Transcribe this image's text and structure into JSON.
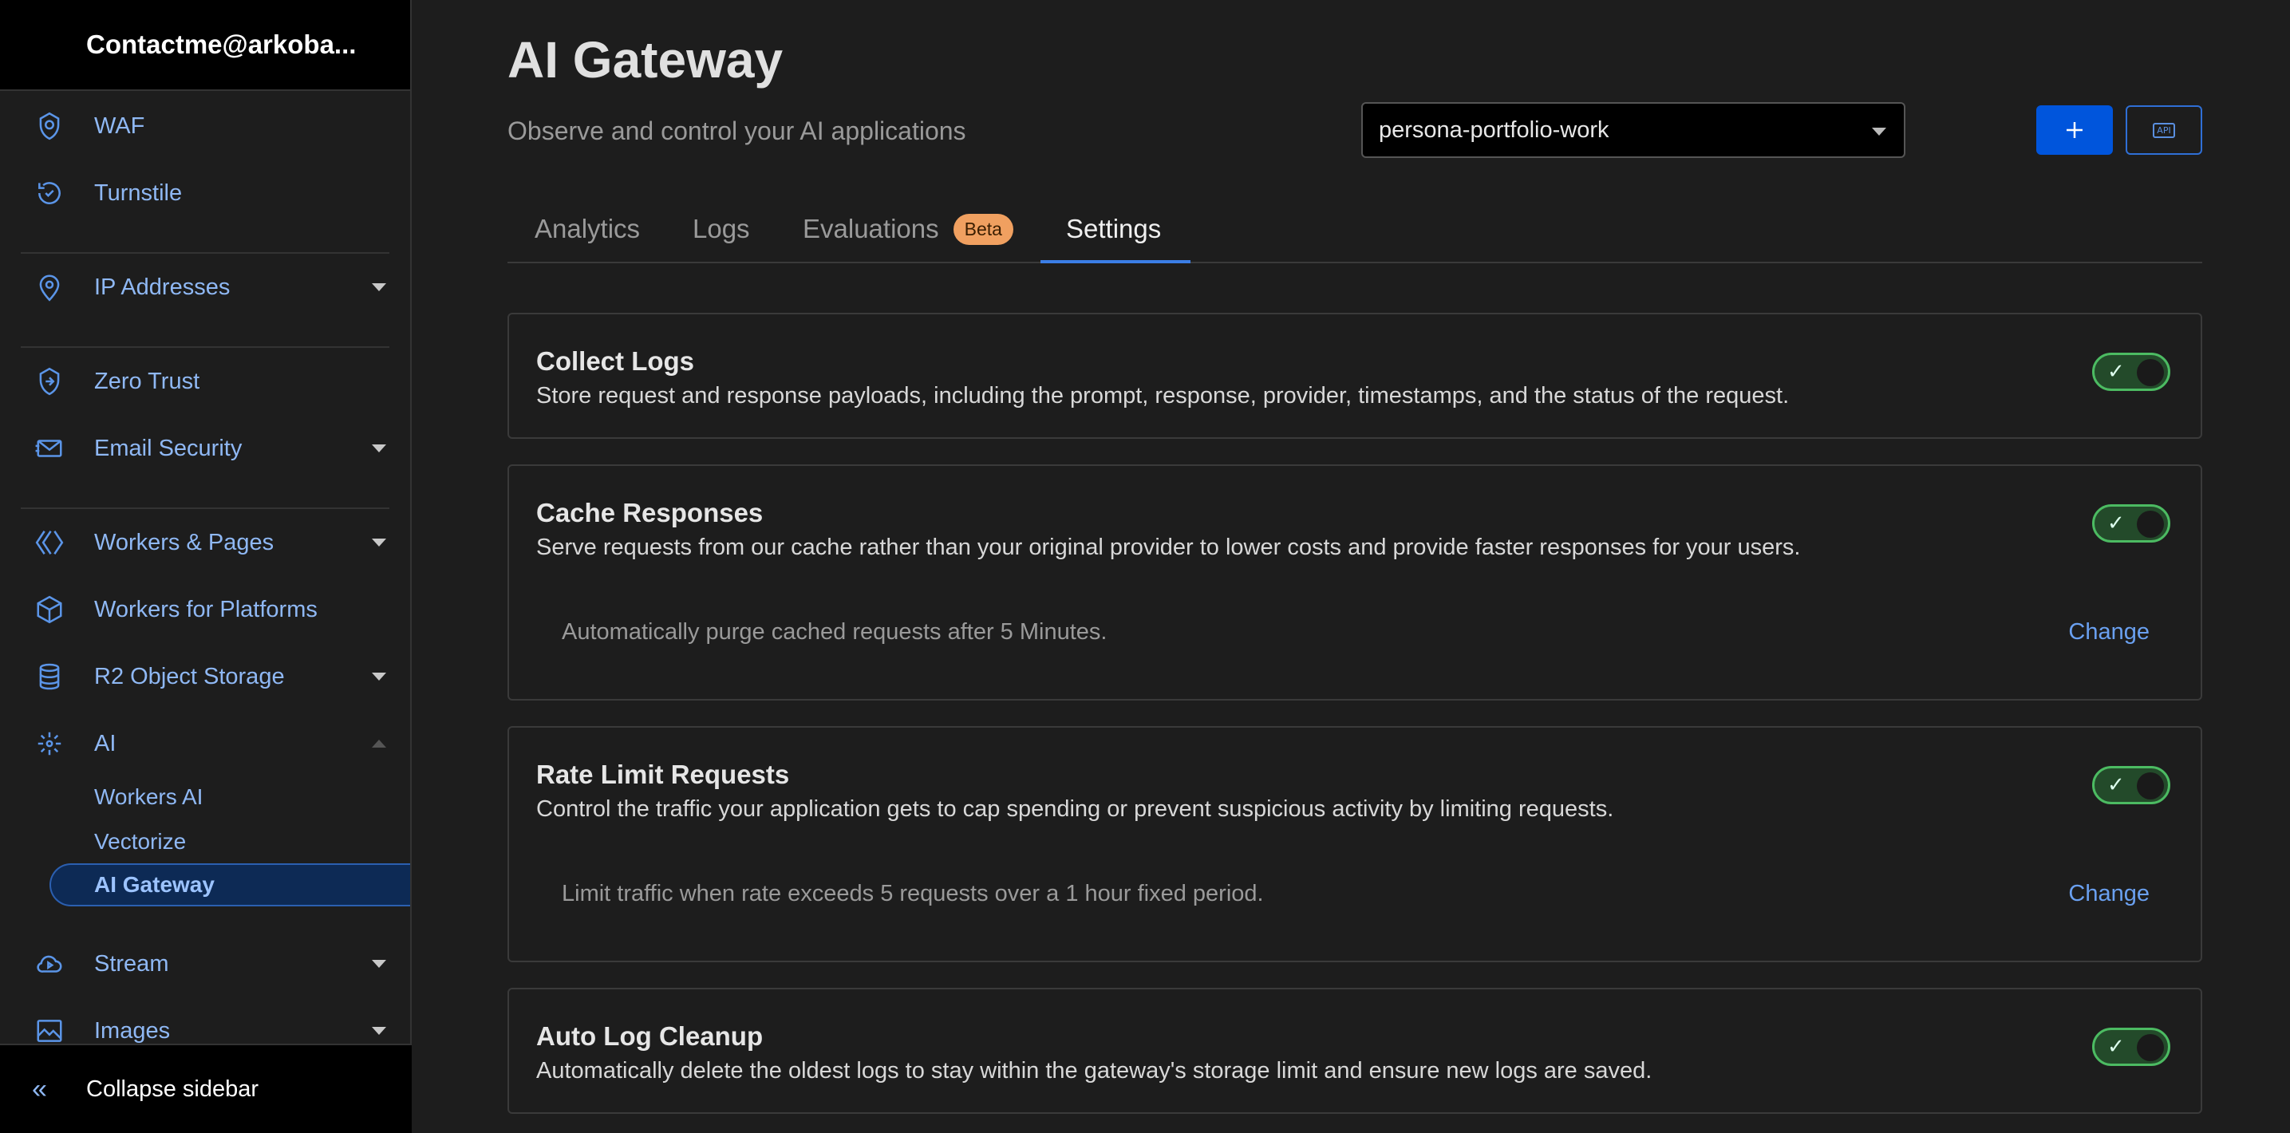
{
  "sidebar": {
    "account": "Contactme@arkoba...",
    "items": [
      {
        "label": "WAF"
      },
      {
        "label": "Turnstile"
      },
      {
        "label": "IP Addresses"
      },
      {
        "label": "Zero Trust"
      },
      {
        "label": "Email Security"
      },
      {
        "label": "Workers & Pages"
      },
      {
        "label": "Workers for Platforms"
      },
      {
        "label": "R2 Object Storage"
      },
      {
        "label": "AI"
      },
      {
        "label": "Stream"
      },
      {
        "label": "Images"
      }
    ],
    "ai_sub": [
      "Workers AI",
      "Vectorize",
      "AI Gateway"
    ],
    "collapse_label": "Collapse sidebar"
  },
  "header": {
    "title": "AI Gateway",
    "subtitle": "Observe and control your AI applications",
    "gateway_select": "persona-portfolio-work",
    "api_chip": "API"
  },
  "tabs": [
    {
      "label": "Analytics"
    },
    {
      "label": "Logs"
    },
    {
      "label": "Evaluations",
      "badge": "Beta"
    },
    {
      "label": "Settings"
    }
  ],
  "settings": {
    "collect_logs": {
      "title": "Collect Logs",
      "desc": "Store request and response payloads, including the prompt, response, provider, timestamps, and the status of the request.",
      "enabled": true
    },
    "cache": {
      "title": "Cache Responses",
      "desc": "Serve requests from our cache rather than your original provider to lower costs and provide faster responses for your users.",
      "detail": "Automatically purge cached requests after 5 Minutes.",
      "change": "Change",
      "enabled": true
    },
    "rate_limit": {
      "title": "Rate Limit Requests",
      "desc": "Control the traffic your application gets to cap spending or prevent suspicious activity by limiting requests.",
      "detail": "Limit traffic when rate exceeds 5 requests over a 1 hour fixed period.",
      "change": "Change",
      "enabled": true
    },
    "auto_cleanup": {
      "title": "Auto Log Cleanup",
      "desc": "Automatically delete the oldest logs to stay within the gateway's storage limit and ensure new logs are saved.",
      "enabled": true
    }
  },
  "colors": {
    "accent": "#0055dc",
    "link": "#6aa0f0",
    "toggle_on": "#4cbb62",
    "badge": "#f0a060"
  }
}
